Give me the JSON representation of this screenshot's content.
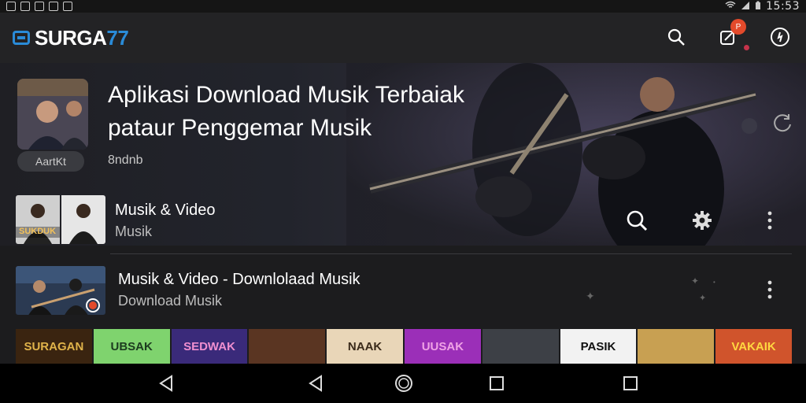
{
  "status_bar": {
    "time": "15:53"
  },
  "app": {
    "logo_main": "SURGA",
    "logo_accent": "77",
    "notification_badge": "P"
  },
  "hero": {
    "title_line1": "Aplikasi Download Musik Terbaiak",
    "title_line2": "pataur Penggemar Musik",
    "chip": "AartKt",
    "subtitle": "8ndnb"
  },
  "list": [
    {
      "title": "Musik & Video",
      "subtitle": "Musik",
      "thumb_text": "SUKDUK"
    },
    {
      "title": "Musik & Video - Downlolaad Musik",
      "subtitle": "Download Musik",
      "thumb_text": ""
    }
  ],
  "strip": [
    {
      "label": "SURAGAN",
      "color": "#e0b34a",
      "bg": "#3a2410"
    },
    {
      "label": "UBSAK",
      "color": "#1c3b1f",
      "bg": "#7fd36e"
    },
    {
      "label": "SEDWAK",
      "color": "#f08fd0",
      "bg": "#3a2a7a"
    },
    {
      "label": "",
      "color": "#fff",
      "bg": "#5a3522"
    },
    {
      "label": "NAAK",
      "color": "#3a2a1a",
      "bg": "#e9d6b8"
    },
    {
      "label": "UUSAK",
      "color": "#f0a2e6",
      "bg": "#9b2fb8"
    },
    {
      "label": "",
      "color": "#fff",
      "bg": "#3d4046"
    },
    {
      "label": "PASIK",
      "color": "#111",
      "bg": "#f2f2f2"
    },
    {
      "label": "",
      "color": "#fff",
      "bg": "#c8a052"
    },
    {
      "label": "VAKAIK",
      "color": "#ffd740",
      "bg": "#d0542c"
    }
  ],
  "colors": {
    "accent": "#2a8bd8",
    "badge": "#e34a2b"
  }
}
